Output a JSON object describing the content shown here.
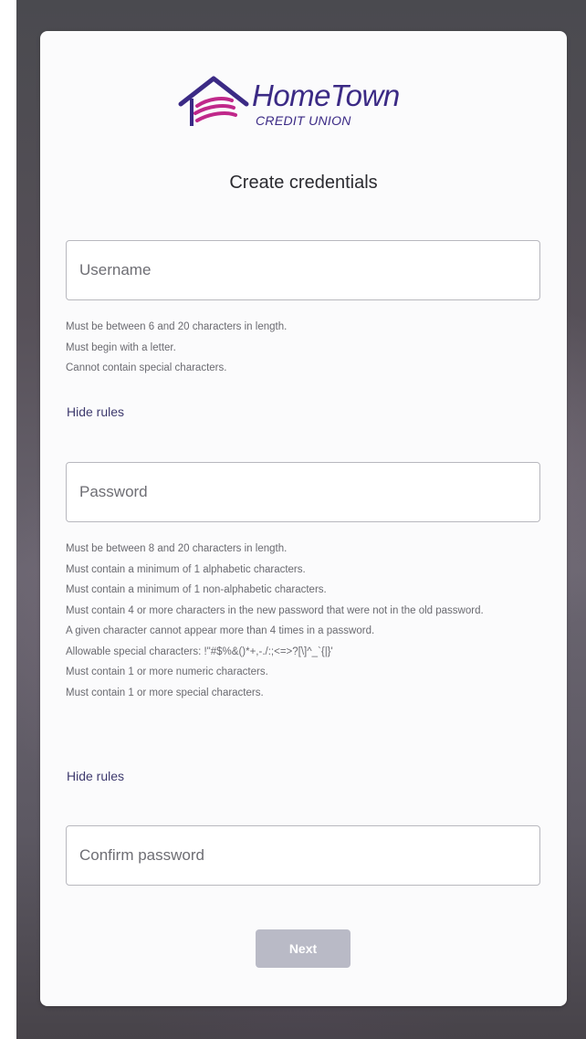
{
  "brand": {
    "name": "HomeTown",
    "subtitle": "CREDIT UNION",
    "primary_color": "#3b2a85",
    "accent_color": "#c0288a"
  },
  "page": {
    "title": "Create credentials"
  },
  "username": {
    "placeholder": "Username",
    "rules": [
      "Must be between 6 and 20 characters in length.",
      "Must begin with a letter.",
      "Cannot contain special characters."
    ],
    "toggle_label": "Hide rules"
  },
  "password": {
    "placeholder": "Password",
    "rules": [
      "Must be between 8 and 20 characters in length.",
      "Must contain a minimum of 1 alphabetic characters.",
      "Must contain a minimum of 1 non-alphabetic characters.",
      "Must contain 4 or more characters in the new password that were not in the old password.",
      "A given character cannot appear more than 4 times in a password.",
      "Allowable special characters: !\"#$%&()*+,-./:;<=>?[\\]^_`{|}'",
      "Must contain 1 or more numeric characters.",
      "Must contain 1 or more special characters."
    ],
    "toggle_label": "Hide rules"
  },
  "confirm_password": {
    "placeholder": "Confirm password"
  },
  "actions": {
    "next_label": "Next",
    "next_color": "#b9bac6"
  }
}
